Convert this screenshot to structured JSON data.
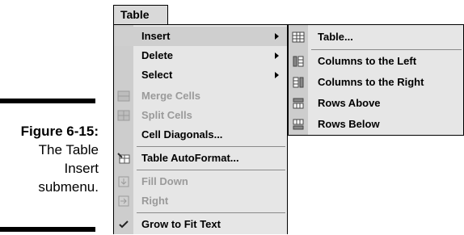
{
  "caption": {
    "label": "Figure 6-15:",
    "text_lines": [
      "The Table",
      "Insert",
      "submenu."
    ]
  },
  "menubar": {
    "tab_label": "Table"
  },
  "menu": {
    "items": [
      {
        "label": "Insert",
        "icon": "none",
        "disabled": false,
        "has_submenu": true,
        "highlighted": true
      },
      {
        "label": "Delete",
        "icon": "none",
        "disabled": false,
        "has_submenu": true
      },
      {
        "label": "Select",
        "icon": "none",
        "disabled": false,
        "has_submenu": true
      },
      {
        "label": "Merge Cells",
        "icon": "merge-cells-icon",
        "disabled": true
      },
      {
        "label": "Split Cells",
        "icon": "split-cells-icon",
        "disabled": true
      },
      {
        "label": "Cell Diagonals...",
        "icon": "none",
        "disabled": false
      },
      {
        "label": "Table AutoFormat...",
        "icon": "autoformat-icon",
        "disabled": false
      },
      {
        "label": "Fill Down",
        "icon": "fill-down-icon",
        "disabled": true
      },
      {
        "label": "Right",
        "icon": "fill-right-icon",
        "disabled": true
      },
      {
        "label": "Grow to Fit Text",
        "icon": "checkmark-icon",
        "disabled": false,
        "checked": true
      }
    ]
  },
  "submenu": {
    "items": [
      {
        "label": "Table...",
        "icon": "table-icon"
      },
      {
        "label": "Columns to the Left",
        "icon": "columns-left-icon"
      },
      {
        "label": "Columns to the Right",
        "icon": "columns-right-icon"
      },
      {
        "label": "Rows Above",
        "icon": "rows-above-icon"
      },
      {
        "label": "Rows Below",
        "icon": "rows-below-icon"
      }
    ]
  }
}
